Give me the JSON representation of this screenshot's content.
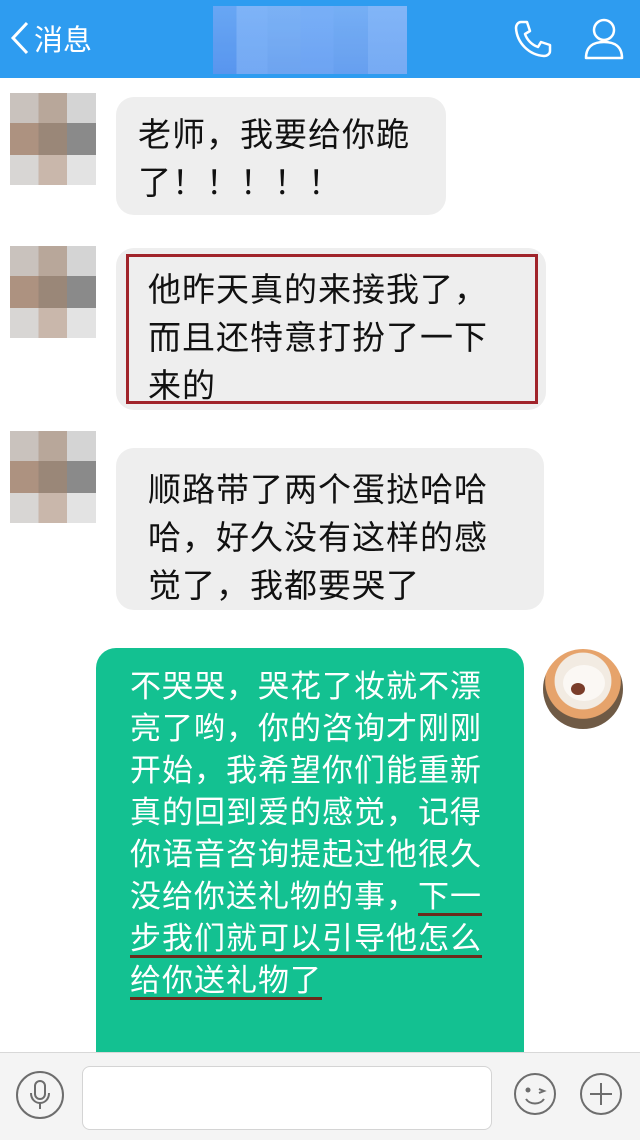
{
  "header": {
    "back_label": "消息",
    "background": "#2e9cf0"
  },
  "messages": [
    {
      "from": "other",
      "lines": "老师，我要给你跪\n了！！！！！",
      "highlighted": false
    },
    {
      "from": "other",
      "lines": "他昨天真的来接我了，\n而且还特意打扮了一下\n来的",
      "highlighted": true
    },
    {
      "from": "other",
      "lines": "顺路带了两个蛋挞哈哈\n哈，好久没有这样的感\n觉了，我都要哭了",
      "highlighted": false
    }
  ],
  "reply": {
    "from": "me",
    "text_plain": "不哭哭，哭花了妆就不漂亮了哟，你的咨询才刚刚开始，我希望你们能重新真的回到爱的感觉，记得你语音咨询提起过他很久没给你送礼物的事，",
    "text_underlined": "下一步我们就可以引导他怎么给你送礼物了",
    "bubble_color": "#13c191"
  },
  "colors": {
    "incoming_bubble": "#eeeeee",
    "highlight_border": "#a0232a"
  },
  "icons": {
    "back": "chevron-left-icon",
    "phone": "phone-icon",
    "user": "user-icon",
    "mic": "mic-icon",
    "emoji": "smiley-icon",
    "plus": "plus-icon"
  }
}
